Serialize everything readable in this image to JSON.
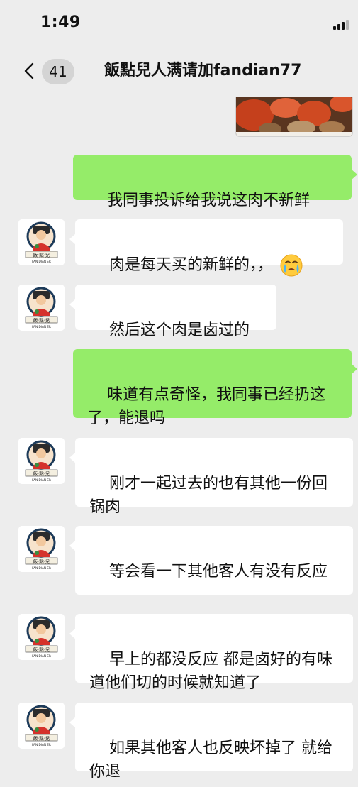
{
  "status": {
    "time": "1:49"
  },
  "nav": {
    "badge_count": "41",
    "title": "飯點兒人满请加fandian77"
  },
  "avatar": {
    "brand_cn": "飯·點·兒",
    "brand_en": "FAN DIAN ER"
  },
  "messages": [
    {
      "sender": "me",
      "text": "我同事投诉给我说这肉不新鲜"
    },
    {
      "sender": "them",
      "text": "肉是每天买的新鲜的，，",
      "emoji": "crying-face"
    },
    {
      "sender": "them",
      "text": "然后这个肉是卤过的"
    },
    {
      "sender": "me",
      "text": "味道有点奇怪，我同事已经扔这了，能退吗"
    },
    {
      "sender": "them",
      "text": "刚才一起过去的也有其他一份回锅肉"
    },
    {
      "sender": "them",
      "text": "等会看一下其他客人有没有反应"
    },
    {
      "sender": "them",
      "text": "早上的都没反应 都是卤好的有味道他们切的时候就知道了"
    },
    {
      "sender": "them",
      "text": "如果其他客人也反映坏掉了 就给你退"
    }
  ]
}
